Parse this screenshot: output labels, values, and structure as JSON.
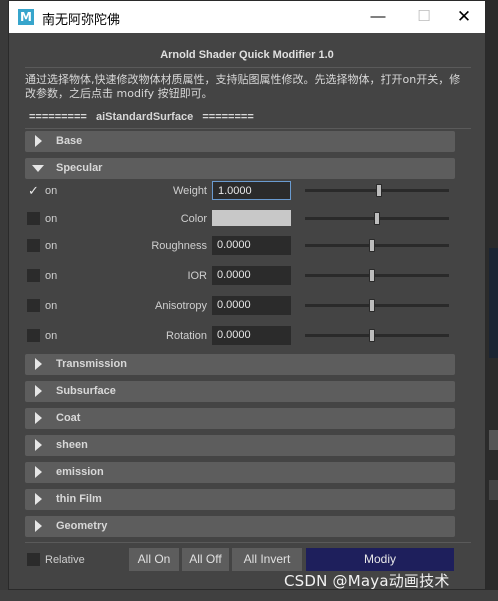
{
  "window": {
    "title": "南无阿弥陀佛",
    "app_icon_letter": "M",
    "controls": {
      "minimize": "—",
      "maximize": "☐",
      "close": "✕"
    }
  },
  "header": {
    "title": "Arnold Shader Quick Modifier 1.0",
    "description": "通过选择物体,快速修改物体材质属性，支持贴图属性修改。先选择物体，打开on开关，修改参数，之后点击 modify 按钮即可。",
    "section": "=========   aiStandardSurface   ========"
  },
  "frames": {
    "base": "Base",
    "specular": "Specular",
    "transmission": "Transmission",
    "subsurface": "Subsurface",
    "coat": "Coat",
    "sheen": "sheen",
    "emission": "emission",
    "thin_film": "thin Film",
    "geometry": "Geometry"
  },
  "specular_rows": [
    {
      "on": true,
      "on_label": "on",
      "label": "Weight",
      "value": "1.0000",
      "slider": 0.66
    },
    {
      "on": false,
      "on_label": "on",
      "label": "Color",
      "value": "",
      "slider": 0.65,
      "color": "#c8c8c8"
    },
    {
      "on": false,
      "on_label": "on",
      "label": "Roughness",
      "value": "0.0000",
      "slider": 0.62
    },
    {
      "on": false,
      "on_label": "on",
      "label": "IOR",
      "value": "0.0000",
      "slider": 0.62
    },
    {
      "on": false,
      "on_label": "on",
      "label": "Anisotropy",
      "value": "0.0000",
      "slider": 0.62
    },
    {
      "on": false,
      "on_label": "on",
      "label": "Rotation",
      "value": "0.0000",
      "slider": 0.62
    }
  ],
  "bottom": {
    "relative_label": "Relative",
    "relative_checked": false,
    "all_on": "All On",
    "all_off": "All Off",
    "all_invert": "All Invert",
    "modify": "Modiy"
  },
  "watermark": "CSDN @Maya动画技术",
  "colors": {
    "panel": "#444444",
    "frame": "#5d5d5d",
    "field": "#2b2b2b",
    "modify_button": "#1e1f5c"
  }
}
